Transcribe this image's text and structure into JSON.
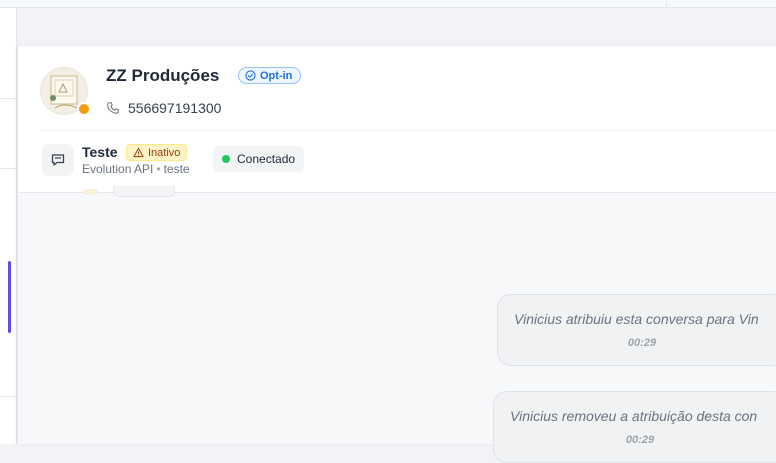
{
  "contact": {
    "name": "ZZ Produções",
    "optin_label": "Opt-in",
    "phone": "556697191300",
    "presence_color": "#f59e0b"
  },
  "inbox": {
    "name": "Teste",
    "status_label": "Inativo",
    "provider": "Evolution API",
    "separator": "•",
    "instance": "teste",
    "connection_label": "Conectado",
    "connection_color": "#22c55e"
  },
  "activity": [
    {
      "message": "Vinicius atribuiu esta conversa para Vin",
      "time": "00:29"
    },
    {
      "message": "Vinicius removeu a atribuição desta con",
      "time": "00:29"
    }
  ],
  "icons": {
    "optin": "check-circle-icon",
    "phone": "phone-icon",
    "inbox": "chat-bubble-icon",
    "inactive": "warning-triangle-icon"
  }
}
